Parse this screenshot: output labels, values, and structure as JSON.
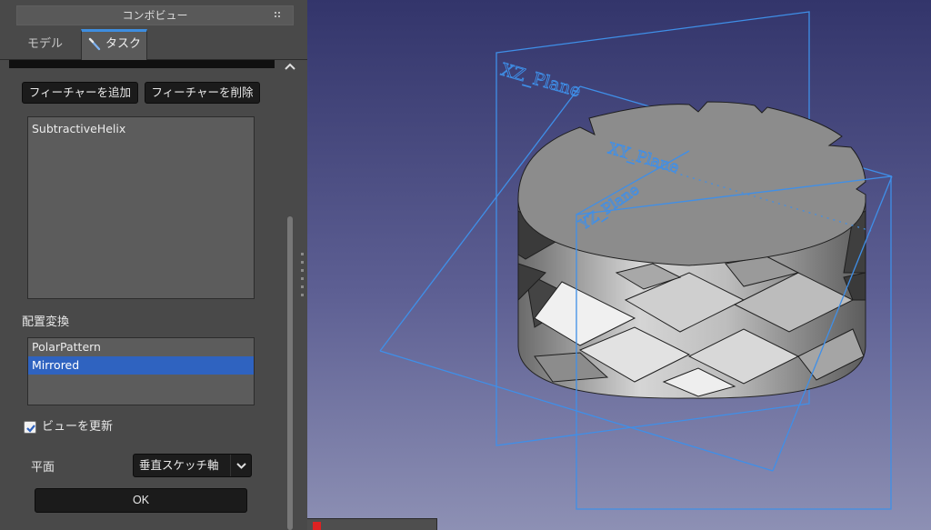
{
  "panel": {
    "title": "コンボビュー",
    "tabs": {
      "model": "モデル",
      "task": "タスク"
    }
  },
  "features": {
    "add_button": "フィーチャーを追加",
    "remove_button": "フィーチャーを削除",
    "items": [
      "SubtractiveHelix"
    ]
  },
  "transformations": {
    "label": "配置変換",
    "items": [
      "PolarPattern",
      "Mirrored"
    ],
    "selected": "Mirrored"
  },
  "options": {
    "update_view_label": "ビューを更新",
    "update_view_checked": true,
    "plane_label": "平面",
    "plane_value": "垂直スケッチ軸",
    "ok_button": "OK"
  },
  "viewport": {
    "planes": [
      "XZ_Plane",
      "XY_Plane",
      "YZ_Plane"
    ],
    "plane_color": "#3f8fe8"
  },
  "colors": {
    "accent": "#3e8ee0",
    "selection": "#2f63c0"
  }
}
